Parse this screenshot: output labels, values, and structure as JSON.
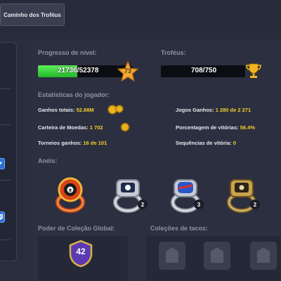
{
  "top_tab": {
    "label": "Caminho dos Troféus"
  },
  "level_progress": {
    "label": "Progresso de nível:",
    "value_text": "21736/52378",
    "fraction": 0.415,
    "level": "73"
  },
  "trophies": {
    "label": "Troféus:",
    "value_text": "708/750"
  },
  "stats": {
    "label": "Estatísticas do jogador:",
    "ganhos_totais": {
      "k": "Ganhos totais:",
      "v": "52.88M"
    },
    "carteira": {
      "k": "Carteira de Moedas:",
      "v": "1 702"
    },
    "torneios": {
      "k": "Torneios ganhos:",
      "v": "16 de 101"
    },
    "jogos_ganhos": {
      "k": "Jogos Ganhos:",
      "v": "1 280 de 2 271"
    },
    "porcentagem": {
      "k": "Porcentagem de vitórias:",
      "v": "56.4%"
    },
    "sequencias": {
      "k": "Sequências de vitória:",
      "v": "0"
    }
  },
  "rings": {
    "label": "Anéis:",
    "items": [
      {
        "icon": "ring-8ball-red-icon",
        "count": ""
      },
      {
        "icon": "ring-silver-icon",
        "count": "2"
      },
      {
        "icon": "ring-silver-blue-icon",
        "count": "3"
      },
      {
        "icon": "ring-gold-icon",
        "count": "2"
      }
    ]
  },
  "collection_power": {
    "label": "Poder de Coleção Global:",
    "value": "42"
  },
  "cue_collections": {
    "label": "Coleções de tacos:"
  },
  "colors": {
    "progress_green": "#3fd33a",
    "stat_value_yellow": "#f2cf2e",
    "shield_purple": "#5b3ab3"
  }
}
